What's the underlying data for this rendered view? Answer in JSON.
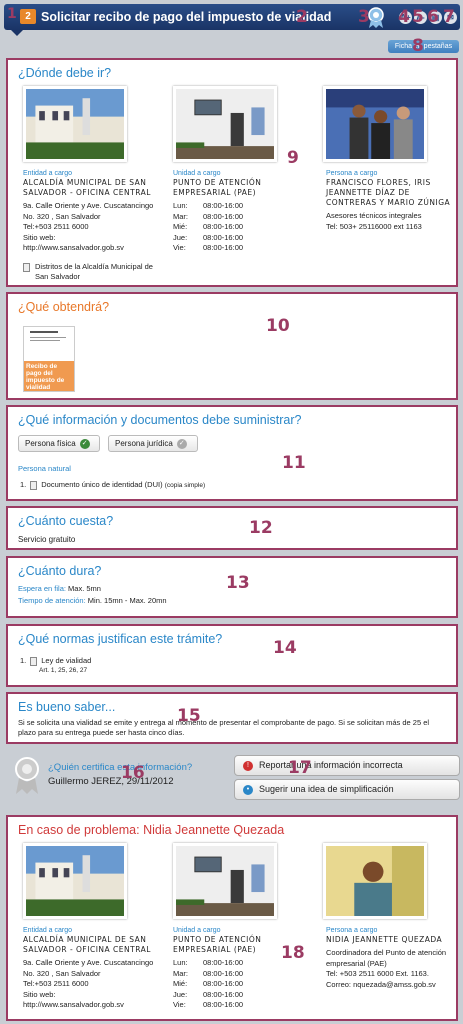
{
  "header": {
    "step_number": "2",
    "title": "Solicitar recibo de pago del impuesto de vialidad",
    "ficha_button": "Ficha en pestañas",
    "tool_icons": [
      "A+",
      "A-",
      "print-icon",
      "mail-icon"
    ]
  },
  "annotations": [
    "1",
    "2",
    "3",
    "4",
    "5",
    "6",
    "7",
    "8",
    "9",
    "10",
    "11",
    "12",
    "13",
    "14",
    "15",
    "16",
    "17",
    "18"
  ],
  "donde": {
    "title": "¿Dónde debe ir?",
    "entidad": {
      "label": "Entidad a cargo",
      "name": "ALCALDÍA MUNICIPAL DE SAN SALVADOR - OFICINA CENTRAL",
      "address": "9a. Calle Oriente y Ave. Cuscatancingo No. 320 , San Salvador",
      "tel": "Tel:+503 2511 6000",
      "web": "Sitio web: http://www.sansalvador.gob.sv",
      "distritos": "Distritos de la Alcaldía Municipal de San Salvador"
    },
    "unidad": {
      "label": "Unidad a cargo",
      "name": "PUNTO DE ATENCIÓN EMPRESARIAL (PAE)",
      "hours": [
        [
          "Lun:",
          "08:00-16:00"
        ],
        [
          "Mar:",
          "08:00-16:00"
        ],
        [
          "Mié:",
          "08:00-16:00"
        ],
        [
          "Jue:",
          "08:00-16:00"
        ],
        [
          "Vie:",
          "08:00-16:00"
        ]
      ]
    },
    "persona": {
      "label": "Persona a cargo",
      "name": "FRANCISCO FLORES, IRIS JEANNETTE DÍAZ DE CONTRERAS Y MARIO ZÚNIGA",
      "role": "Asesores técnicos integrales",
      "tel": "Tel: 503+ 25116000 ext 1163"
    }
  },
  "obtendra": {
    "title": "¿Qué obtendrá?",
    "doc_label": "Recibo de pago del impuesto de vialidad"
  },
  "info": {
    "title": "¿Qué información y documentos debe suministrar?",
    "tab_fisica": "Persona física",
    "tab_juridica": "Persona jurídica",
    "subhead": "Persona natural",
    "item_num": "1.",
    "item": "Documento único de identidad (DUI)",
    "item_note": "(copia simple)"
  },
  "cuesta": {
    "title": "¿Cuánto cuesta?",
    "value": "Servicio gratuito"
  },
  "dura": {
    "title": "¿Cuánto dura?",
    "espera_label": "Espera en fila:",
    "espera": "Max. 5mn",
    "tiempo_label": "Tiempo de atención:",
    "tiempo": "Min. 15mn - Max. 20mn"
  },
  "normas": {
    "title": "¿Qué normas justifican este trámite?",
    "item_num": "1.",
    "ley": "Ley de vialidad",
    "art": "Art. 1, 25, 26, 27"
  },
  "bueno": {
    "title": "Es bueno saber...",
    "text": "Si se solicita una vialidad se emite y entrega al momento de presentar el comprobante de pago. Si se solicitan más de 25 el plazo para su entrega puede ser hasta cinco días."
  },
  "certifica": {
    "question": "¿Quién certifica esta información?",
    "who": "Guillermo JEREZ, 29/11/2012"
  },
  "report": {
    "incorrect": "Reportar una información incorrecta",
    "suggest": "Sugerir una idea de simplificación"
  },
  "problema": {
    "title": "En caso de problema: Nidia Jeannette Quezada",
    "entidad": {
      "label": "Entidad a cargo",
      "name": "ALCALDÍA MUNICIPAL DE SAN SALVADOR - OFICINA CENTRAL",
      "address": "9a. Calle Oriente y Ave. Cuscatancingo No. 320 , San Salvador",
      "tel": "Tel:+503 2511 6000",
      "web": "Sitio web: http://www.sansalvador.gob.sv"
    },
    "unidad": {
      "label": "Unidad a cargo",
      "name": "PUNTO DE ATENCIÓN EMPRESARIAL (PAE)",
      "hours": [
        [
          "Lun:",
          "08:00-16:00"
        ],
        [
          "Mar:",
          "08:00-16:00"
        ],
        [
          "Mié:",
          "08:00-16:00"
        ],
        [
          "Jue:",
          "08:00-16:00"
        ],
        [
          "Vie:",
          "08:00-16:00"
        ]
      ]
    },
    "persona": {
      "label": "Persona a cargo",
      "name": "NIDIA JEANNETTE QUEZADA",
      "role": "Coordinadora del Punto de atención empresarial (PAE)",
      "tel": "Tel: +503 2511 6000 Ext. 1163.",
      "mail": "Correo: nquezada@amss.gob.sv"
    }
  },
  "colors": {
    "accent": "#2a87c8",
    "frame": "#9b3b63",
    "header": "#1a3466",
    "orange": "#e8782a"
  }
}
